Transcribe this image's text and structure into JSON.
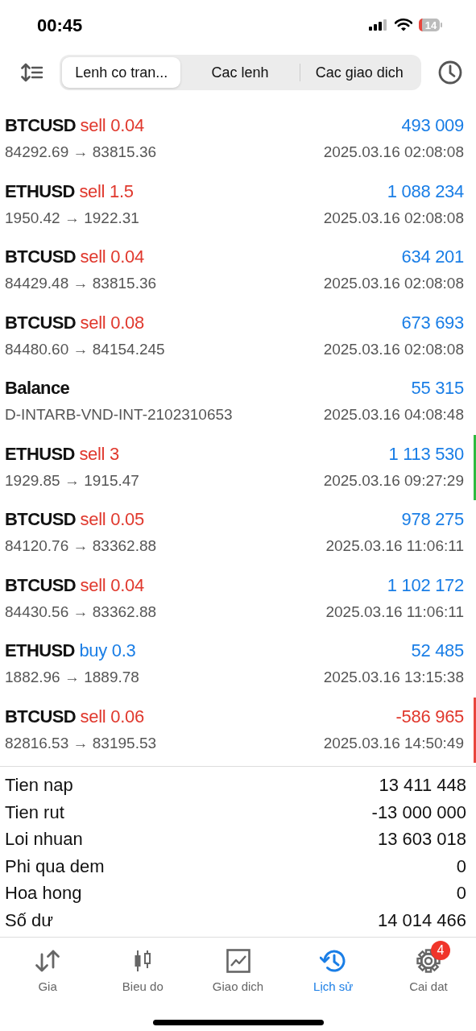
{
  "status_bar": {
    "time": "00:45",
    "battery": "14"
  },
  "tabs": [
    {
      "label": "Lenh co tran...",
      "selected": true
    },
    {
      "label": "Cac lenh",
      "selected": false
    },
    {
      "label": "Cac giao dich",
      "selected": false
    }
  ],
  "deals": [
    {
      "kind": "trade",
      "symbol": "BTCUSD",
      "side": "sell",
      "volume": "0.04",
      "prices": "84292.69 → 83815.36",
      "profit": "493 009",
      "loss": false,
      "time": "2025.03.16 02:08:08"
    },
    {
      "kind": "trade",
      "symbol": "ETHUSD",
      "side": "sell",
      "volume": "1.5",
      "prices": "1950.42 → 1922.31",
      "profit": "1 088 234",
      "loss": false,
      "time": "2025.03.16 02:08:08"
    },
    {
      "kind": "trade",
      "symbol": "BTCUSD",
      "side": "sell",
      "volume": "0.04",
      "prices": "84429.48 → 83815.36",
      "profit": "634 201",
      "loss": false,
      "time": "2025.03.16 02:08:08"
    },
    {
      "kind": "trade",
      "symbol": "BTCUSD",
      "side": "sell",
      "volume": "0.08",
      "prices": "84480.60 → 84154.245",
      "profit": "673 693",
      "loss": false,
      "time": "2025.03.16 02:08:08"
    },
    {
      "kind": "balance",
      "symbol": "Balance",
      "prices": "D-INTARB-VND-INT-2102310653",
      "profit": "55 315",
      "loss": false,
      "time": "2025.03.16 04:08:48"
    },
    {
      "kind": "trade",
      "symbol": "ETHUSD",
      "side": "sell",
      "volume": "3",
      "prices": "1929.85 → 1915.47",
      "profit": "1 113 530",
      "loss": false,
      "time": "2025.03.16 09:27:29",
      "color": "#2dbb3f"
    },
    {
      "kind": "trade",
      "symbol": "BTCUSD",
      "side": "sell",
      "volume": "0.05",
      "prices": "84120.76 → 83362.88",
      "profit": "978 275",
      "loss": false,
      "time": "2025.03.16 11:06:11"
    },
    {
      "kind": "trade",
      "symbol": "BTCUSD",
      "side": "sell",
      "volume": "0.04",
      "prices": "84430.56 → 83362.88",
      "profit": "1 102 172",
      "loss": false,
      "time": "2025.03.16 11:06:11"
    },
    {
      "kind": "trade",
      "symbol": "ETHUSD",
      "side": "buy",
      "volume": "0.3",
      "prices": "1882.96 → 1889.78",
      "profit": "52 485",
      "loss": false,
      "time": "2025.03.16 13:15:38"
    },
    {
      "kind": "trade",
      "symbol": "BTCUSD",
      "side": "sell",
      "volume": "0.06",
      "prices": "82816.53 → 83195.53",
      "profit": "-586 965",
      "loss": true,
      "time": "2025.03.16 14:50:49",
      "color": "#e8463d"
    }
  ],
  "summary": [
    {
      "label": "Tien nap",
      "value": "13 411 448"
    },
    {
      "label": "Tien rut",
      "value": "-13 000 000"
    },
    {
      "label": "Loi nhuan",
      "value": "13 603 018"
    },
    {
      "label": "Phi qua dem",
      "value": "0"
    },
    {
      "label": "Hoa hong",
      "value": "0"
    },
    {
      "label": "Số dư",
      "value": "14 014 466"
    }
  ],
  "nav": [
    {
      "kind": "quotes",
      "label": "Gia",
      "selected": false
    },
    {
      "kind": "chart",
      "label": "Bieu do",
      "selected": false
    },
    {
      "kind": "trade",
      "label": "Giao dich",
      "selected": false
    },
    {
      "kind": "history",
      "label": "Lịch sử",
      "selected": true
    },
    {
      "kind": "settings",
      "label": "Cai dat",
      "selected": false,
      "badge": "4"
    }
  ]
}
